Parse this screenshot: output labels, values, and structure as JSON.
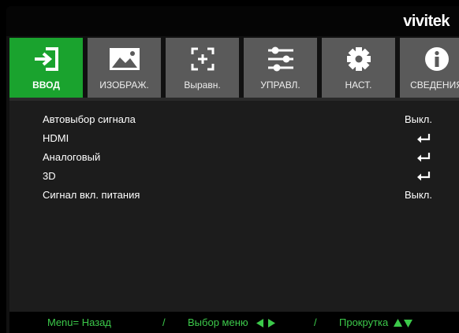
{
  "brand": {
    "logo": "vivitek"
  },
  "tabs": [
    {
      "label": "ВВОД",
      "icon": "input-icon",
      "active": true
    },
    {
      "label": "ИЗОБРАЖ.",
      "icon": "image-icon",
      "active": false
    },
    {
      "label": "Выравн.",
      "icon": "alignment-icon",
      "active": false
    },
    {
      "label": "УПРАВЛ.",
      "icon": "sliders-icon",
      "active": false
    },
    {
      "label": "НАСТ.",
      "icon": "gear-icon",
      "active": false
    },
    {
      "label": "СВЕДЕНИЯ",
      "icon": "info-icon",
      "active": false
    }
  ],
  "menu": {
    "items": [
      {
        "label": "Автовыбор сигнала",
        "value": "Выкл."
      },
      {
        "label": "HDMI",
        "value": "",
        "icon": "enter-icon"
      },
      {
        "label": "Аналоговый",
        "value": "",
        "icon": "enter-icon"
      },
      {
        "label": "3D",
        "value": "",
        "icon": "enter-icon"
      },
      {
        "label": "Сигнал вкл. питания",
        "value": "Выкл."
      }
    ]
  },
  "footer": {
    "back": "Menu= Назад",
    "sep1": "/",
    "select": "Выбор меню",
    "sep2": "/",
    "scroll": "Прокрутка"
  },
  "colors": {
    "active_tab": "#1aa32e",
    "inactive_tab": "#5a5a5a",
    "footer_text": "#3cc94a"
  }
}
